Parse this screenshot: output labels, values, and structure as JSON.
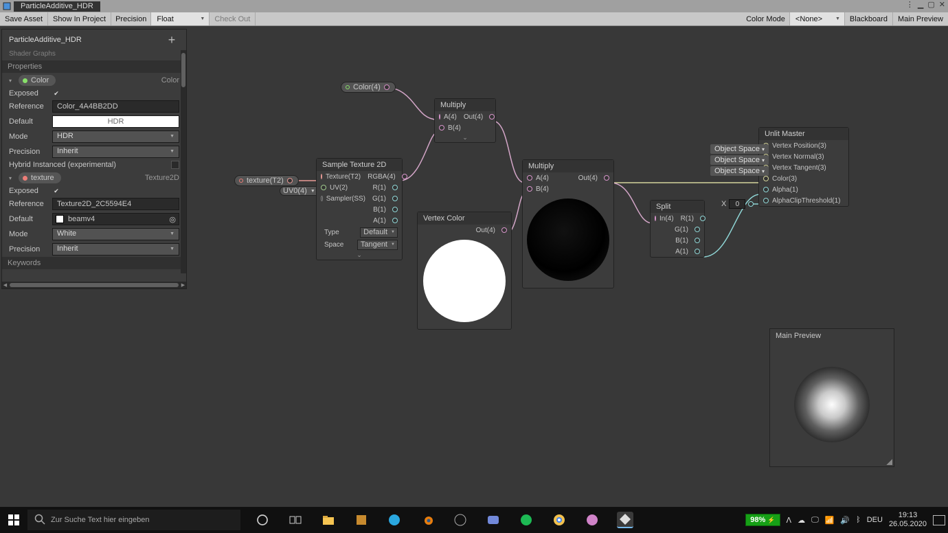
{
  "window": {
    "title": "ParticleAdditive_HDR"
  },
  "toolbar": {
    "save": "Save Asset",
    "show": "Show In Project",
    "precision_label": "Precision",
    "precision_value": "Float",
    "checkout": "Check Out",
    "color_mode_label": "Color Mode",
    "color_mode_value": "<None>",
    "blackboard": "Blackboard",
    "main_preview": "Main Preview"
  },
  "blackboard": {
    "title": "ParticleAdditive_HDR",
    "subtitle": "Shader Graphs",
    "properties_header": "Properties",
    "items": [
      {
        "chip": "Color",
        "type_label": "Color",
        "dot_color": "#88e06a",
        "rows": {
          "exposed_label": "Exposed",
          "exposed": true,
          "reference_label": "Reference",
          "reference": "Color_4A4BB2DD",
          "default_label": "Default",
          "default_display": "HDR",
          "mode_label": "Mode",
          "mode": "HDR",
          "precision_label": "Precision",
          "precision": "Inherit",
          "hybrid_label": "Hybrid Instanced (experimental)",
          "hybrid": false
        }
      },
      {
        "chip": "texture",
        "type_label": "Texture2D",
        "dot_color": "#ed7e78",
        "rows": {
          "exposed_label": "Exposed",
          "exposed": true,
          "reference_label": "Reference",
          "reference": "Texture2D_2C5594E4",
          "default_label": "Default",
          "default_display": "beamv4",
          "mode_label": "Mode",
          "mode": "White",
          "precision_label": "Precision",
          "precision": "Inherit"
        }
      }
    ],
    "keywords_header": "Keywords"
  },
  "graph": {
    "color_pill": "Color(4)",
    "texture_pill": "texture(T2)",
    "uv_pill": "UV0(4)",
    "multiply1": {
      "title": "Multiply",
      "a": "A(4)",
      "b": "B(4)",
      "out": "Out(4)"
    },
    "sample": {
      "title": "Sample Texture 2D",
      "in_tex": "Texture(T2)",
      "in_uv": "UV(2)",
      "in_samp": "Sampler(SS)",
      "out_rgba": "RGBA(4)",
      "out_r": "R(1)",
      "out_g": "G(1)",
      "out_b": "B(1)",
      "out_a": "A(1)",
      "type_label": "Type",
      "type_value": "Default",
      "space_label": "Space",
      "space_value": "Tangent"
    },
    "vcolor": {
      "title": "Vertex Color",
      "out": "Out(4)"
    },
    "multiply2": {
      "title": "Multiply",
      "a": "A(4)",
      "b": "B(4)",
      "out": "Out(4)"
    },
    "split": {
      "title": "Split",
      "in": "In(4)",
      "r": "R(1)",
      "g": "G(1)",
      "b": "B(1)",
      "a": "A(1)"
    },
    "xfield": {
      "label": "X",
      "value": "0"
    },
    "master": {
      "title": "Unlit Master",
      "space": "Object Space",
      "vpos": "Vertex Position(3)",
      "vnorm": "Vertex Normal(3)",
      "vtan": "Vertex Tangent(3)",
      "color": "Color(3)",
      "alpha": "Alpha(1)",
      "clip": "AlphaClipThreshold(1)"
    }
  },
  "main_preview": {
    "title": "Main Preview"
  },
  "taskbar": {
    "search_placeholder": "Zur Suche Text hier eingeben",
    "battery": "98%",
    "lang": "DEU",
    "time": "19:13",
    "date": "26.05.2020"
  }
}
